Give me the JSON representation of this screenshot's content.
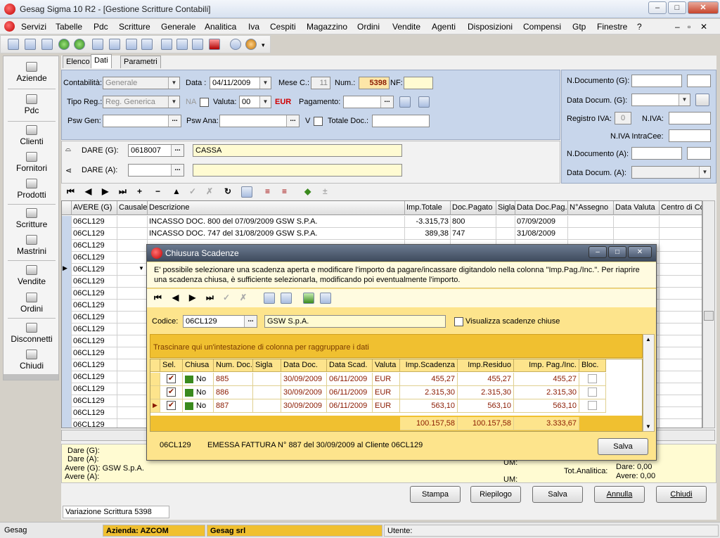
{
  "window": {
    "title": "Gesag Sigma 10 R2 - [Gestione Scritture Contabili]",
    "min": "–",
    "max": "□",
    "close": "✕"
  },
  "menu": [
    "Servizi",
    "Tabelle",
    "Pdc",
    "Scritture",
    "Generale",
    "Analitica",
    "Iva",
    "Cespiti",
    "Magazzino",
    "Ordini",
    "Vendite",
    "Agenti",
    "Disposizioni",
    "Compensi",
    "Gtp",
    "Finestre",
    "?"
  ],
  "mdi_controls": [
    "–",
    "▫",
    "✕"
  ],
  "sidebar": [
    "Aziende",
    "Pdc",
    "Clienti",
    "Fornitori",
    "Prodotti",
    "Scritture",
    "Mastrini",
    "Vendite",
    "Ordini",
    "Disconnetti",
    "Chiudi"
  ],
  "tabs": [
    "Elenco",
    "Dati",
    "Parametri"
  ],
  "form": {
    "contabilita_label": "Contabilità:",
    "contabilita": "Generale",
    "data_label": "Data :",
    "data": "04/11/2009",
    "mese_label": "Mese C.:",
    "mese": "11",
    "num_label": "Num.:",
    "num": "5398",
    "nf_label": "NF:",
    "tiporeg_label": "Tipo Reg.:",
    "tiporeg": "Reg. Generica",
    "na_label": "NA",
    "valuta_label": "Valuta:",
    "valuta": "00",
    "eur": "EUR",
    "pagamento_label": "Pagamento:",
    "pswgen_label": "Psw Gen:",
    "pswana_label": "Psw Ana:",
    "v_label": "V",
    "totdoc_label": "Totale Doc.:"
  },
  "right": {
    "ndocg": "N.Documento (G):",
    "datadocg": "Data Docum. (G):",
    "regiva": "Registro IVA:",
    "regiva_val": "0",
    "niva": "N.IVA:",
    "nivaintra": "N.IVA IntraCee:",
    "ndoca": "N.Documento (A):",
    "datadoca": "Data Docum. (A):"
  },
  "dare": {
    "g_label": "DARE (G):",
    "g_code": "0618007",
    "g_name": "CASSA",
    "a_label": "DARE (A):"
  },
  "grid": {
    "headers": [
      "AVERE (G)",
      "Causale",
      "Descrizione",
      "Imp.Totale",
      "Doc.Pagato",
      "Sigla",
      "Data Doc.Pag.",
      "N°Assegno",
      "Data Valuta",
      "Centro di Co"
    ],
    "rows": [
      {
        "avere": "06CL129",
        "desc": "INCASSO DOC. 800 del 07/09/2009 GSW S.P.A.",
        "imp": "-3.315,73",
        "doc": "800",
        "data": "07/09/2009"
      },
      {
        "avere": "06CL129",
        "desc": "INCASSO DOC. 747 del 31/08/2009 GSW S.P.A.",
        "imp": "389,38",
        "doc": "747",
        "data": "31/08/2009"
      },
      {
        "avere": "06CL129"
      },
      {
        "avere": "06CL129"
      },
      {
        "avere": "06CL129"
      },
      {
        "avere": "06CL129"
      },
      {
        "avere": "06CL129"
      },
      {
        "avere": "06CL129"
      },
      {
        "avere": "06CL129"
      },
      {
        "avere": "06CL129"
      },
      {
        "avere": "06CL129"
      },
      {
        "avere": "06CL129"
      },
      {
        "avere": "06CL129"
      },
      {
        "avere": "06CL129"
      },
      {
        "avere": "06CL129"
      },
      {
        "avere": "06CL129"
      },
      {
        "avere": "06CL129"
      },
      {
        "avere": "06CL129"
      }
    ]
  },
  "bottom": {
    "dareg": "Dare (G):",
    "darea": "Dare (A):",
    "avereg": "Avere (G): GSW S.p.A.",
    "averea": "Avere (A):",
    "um1": "UM:",
    "um2": "UM:",
    "totanalitica": "Tot.Analitica:",
    "dare_val": "Dare:   0,00",
    "avere_val": "Avere:   0,00"
  },
  "buttons": [
    "Stampa",
    "Riepilogo",
    "Salva",
    "Annulla",
    "Chiudi"
  ],
  "variazione": "Variazione Scrittura 5398",
  "status": {
    "app": "Gesag",
    "azienda": "Azienda: AZCOM",
    "ditta": "Gesag srl",
    "utente": "Utente:"
  },
  "dialog": {
    "title": "Chiusura Scadenze",
    "info": "E' possibile selezionare una scadenza aperta e modificare l'importo da pagare/incassare digitandolo nella colonna \"Imp.Pag./Inc.\". Per riaprire una scadenza chiusa, è sufficiente selezionarla, modificando poi eventualmente l'importo.",
    "codice_label": "Codice:",
    "codice": "06CL129",
    "nome": "GSW S.p.A.",
    "visualizza": "Visualizza scadenze chiuse",
    "group_hint": "Trascinare qui un'intestazione di colonna per raggruppare i dati",
    "headers": [
      "Sel.",
      "Chiusa",
      "Num. Doc.",
      "Sigla",
      "Data Doc.",
      "Data Scad.",
      "Valuta",
      "Imp.Scadenza",
      "Imp.Residuo",
      "Imp. Pag./Inc.",
      "Bloc."
    ],
    "rows": [
      {
        "chiusa": "No",
        "num": "885",
        "datadoc": "30/09/2009",
        "datascad": "06/11/2009",
        "valuta": "EUR",
        "impscad": "455,27",
        "impres": "455,27",
        "imppag": "455,27"
      },
      {
        "chiusa": "No",
        "num": "886",
        "datadoc": "30/09/2009",
        "datascad": "06/11/2009",
        "valuta": "EUR",
        "impscad": "2.315,30",
        "impres": "2.315,30",
        "imppag": "2.315,30"
      },
      {
        "chiusa": "No",
        "num": "887",
        "datadoc": "30/09/2009",
        "datascad": "06/11/2009",
        "valuta": "EUR",
        "impscad": "563,10",
        "impres": "563,10",
        "imppag": "563,10"
      }
    ],
    "totals": {
      "impscad": "100.157,58",
      "impres": "100.157,58",
      "imppag": "3.333,67"
    },
    "footer_code": "06CL129",
    "footer_text": "EMESSA FATTURA N° 887 del 30/09/2009 al Cliente 06CL129",
    "save": "Salva"
  }
}
